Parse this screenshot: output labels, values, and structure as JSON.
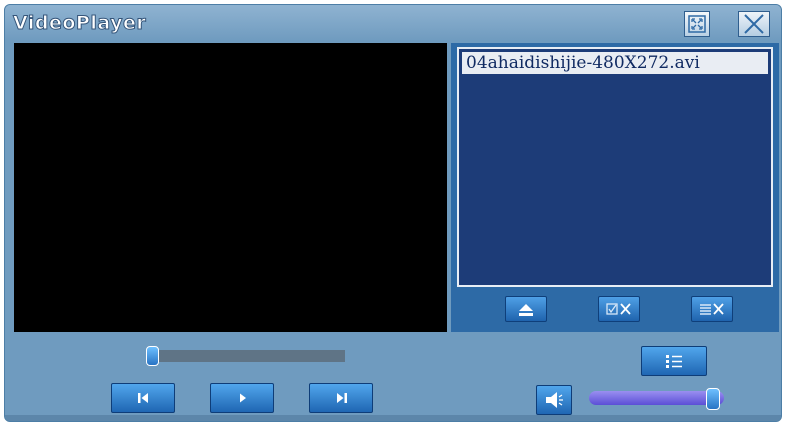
{
  "window": {
    "title": "VideoPlayer"
  },
  "playlist": {
    "items": [
      {
        "label": "04ahaidishijie-480X272.avi",
        "selected": true
      }
    ]
  },
  "controls": {
    "progress": 0.0,
    "volume": 1.0
  },
  "icons": {
    "fullscreen": "fullscreen-icon",
    "close": "close-icon",
    "eject": "eject-icon",
    "remove_selected": "remove-selected-icon",
    "clear_list": "clear-list-icon",
    "playlist_toggle": "playlist-icon",
    "previous": "previous-icon",
    "play": "play-icon",
    "next": "next-icon",
    "volume": "speaker-icon"
  },
  "colors": {
    "window_bg": "#6f9bbf",
    "playlist_bg": "#1d3c78",
    "button_blue": "#2a74c0",
    "volume_bar": "#6a5ee0"
  }
}
